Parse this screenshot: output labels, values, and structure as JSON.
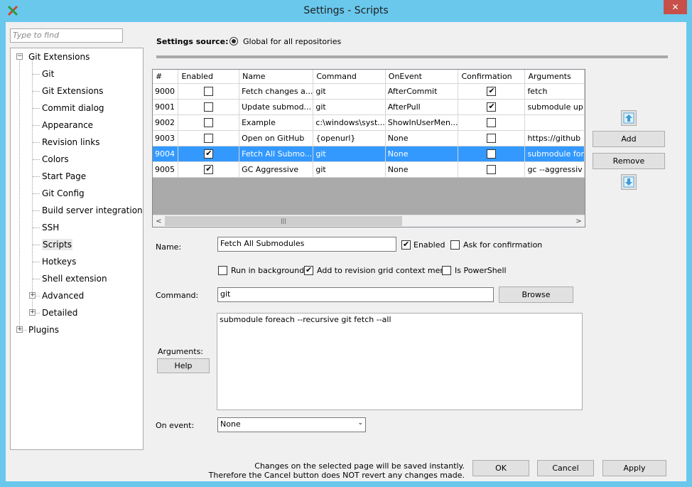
{
  "window": {
    "title": "Settings - Scripts",
    "close_glyph": "✕"
  },
  "search": {
    "placeholder": "Type to find"
  },
  "tree": {
    "root": "Git Extensions",
    "children": [
      "Git",
      "Git Extensions",
      "Commit dialog",
      "Appearance",
      "Revision links",
      "Colors",
      "Start Page",
      "Git Config",
      "Build server integration",
      "SSH",
      "Scripts",
      "Hotkeys",
      "Shell extension",
      "Advanced",
      "Detailed"
    ],
    "plugins": "Plugins",
    "selected": "Scripts"
  },
  "settings_source": {
    "label": "Settings source:",
    "option": "Global for all repositories"
  },
  "grid": {
    "columns": [
      "#",
      "Enabled",
      "Name",
      "Command",
      "OnEvent",
      "Confirmation",
      "Arguments"
    ],
    "rows": [
      {
        "id": "9000",
        "enabled": false,
        "name": "Fetch changes a...",
        "command": "git",
        "onevent": "AfterCommit",
        "confirmation": true,
        "arguments": "fetch"
      },
      {
        "id": "9001",
        "enabled": false,
        "name": "Update submod...",
        "command": "git",
        "onevent": "AfterPull",
        "confirmation": true,
        "arguments": "submodule up"
      },
      {
        "id": "9002",
        "enabled": false,
        "name": "Example",
        "command": "c:\\windows\\syst...",
        "onevent": "ShowInUserMen...",
        "confirmation": false,
        "arguments": ""
      },
      {
        "id": "9003",
        "enabled": false,
        "name": "Open on GitHub",
        "command": "{openurl}",
        "onevent": "None",
        "confirmation": false,
        "arguments": "https://github"
      },
      {
        "id": "9004",
        "enabled": true,
        "name": "Fetch All Submo...",
        "command": "git",
        "onevent": "None",
        "confirmation": false,
        "arguments": "submodule for",
        "selected": true
      },
      {
        "id": "9005",
        "enabled": true,
        "name": "GC Aggressive",
        "command": "git",
        "onevent": "None",
        "confirmation": false,
        "arguments": "gc --aggressiv"
      }
    ],
    "scroll_left": "<",
    "scroll_right": ">",
    "thumb_grip": "|||"
  },
  "side_buttons": {
    "add": "Add",
    "remove": "Remove"
  },
  "form": {
    "name_label": "Name:",
    "name_value": "Fetch All Submodules",
    "enabled_label": "Enabled",
    "enabled": true,
    "ask_confirm_label": "Ask for confirmation",
    "ask_confirm": false,
    "run_bg_label": "Run in background",
    "run_bg": false,
    "add_context_label": "Add to revision grid context menu",
    "add_context": true,
    "powershell_label": "Is PowerShell",
    "powershell": false,
    "command_label": "Command:",
    "command_value": "git",
    "browse_label": "Browse",
    "arguments_label": "Arguments:",
    "help_label": "Help",
    "arguments_value": "submodule foreach --recursive git fetch --all",
    "on_event_label": "On event:",
    "on_event_value": "None"
  },
  "footer": {
    "note_line1": "Changes on the selected page will be saved instantly.",
    "note_line2": "Therefore the Cancel button does NOT revert any changes made.",
    "ok": "OK",
    "cancel": "Cancel",
    "apply": "Apply"
  },
  "colors": {
    "titlebar": "#6ac8ed",
    "selection": "#3399ff",
    "close": "#c7504b"
  }
}
